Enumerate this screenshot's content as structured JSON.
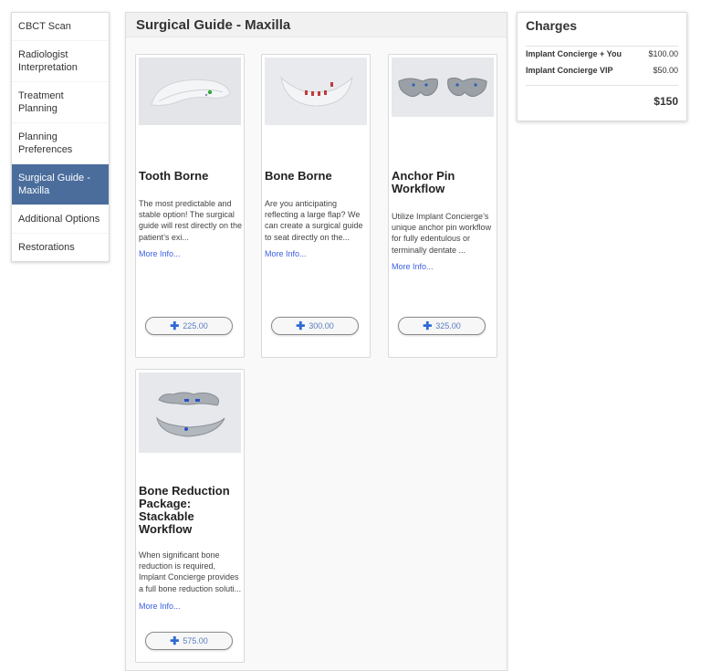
{
  "nav": {
    "items": [
      {
        "label": "CBCT Scan"
      },
      {
        "label": "Radiologist Interpretation"
      },
      {
        "label": "Treatment Planning"
      },
      {
        "label": "Planning Preferences"
      },
      {
        "label": "Surgical Guide - Maxilla",
        "active": true
      },
      {
        "label": "Additional Options"
      },
      {
        "label": "Restorations"
      }
    ]
  },
  "main": {
    "title": "Surgical Guide - Maxilla",
    "cards": [
      {
        "title": "Tooth Borne",
        "description": "The most predictable and stable option! The surgical guide will rest directly on the patient’s exi...",
        "more": "More Info...",
        "price": "225.00",
        "image_icon": "tooth-borne-guide-image"
      },
      {
        "title": "Bone Borne",
        "description": "Are you anticipating reflecting a large flap? We can create a surgical guide to seat directly on the...",
        "more": "More Info...",
        "price": "300.00",
        "image_icon": "bone-borne-guide-image"
      },
      {
        "title": "Anchor Pin Workflow",
        "description": "Utilize Implant Concierge’s unique anchor pin workflow for fully edentulous or terminally dentate ...",
        "more": "More Info...",
        "price": "325.00",
        "image_icon": "anchor-pin-guide-image"
      },
      {
        "title": "Bone Reduction Package: Stackable Workflow",
        "description": "When significant bone reduction is required, Implant Concierge provides a full bone reduction soluti...",
        "more": "More Info...",
        "price": "575.00",
        "image_icon": "stackable-guide-image"
      }
    ]
  },
  "charges": {
    "title": "Charges",
    "items": [
      {
        "label": "Implant Concierge + You",
        "amount": "$100.00"
      },
      {
        "label": "Implant Concierge VIP",
        "amount": "$50.00"
      }
    ],
    "total": "$150"
  },
  "colors": {
    "nav_active": "#4a6d9c",
    "link": "#3a5ee0",
    "plus_icon": "#2e6ad3"
  }
}
